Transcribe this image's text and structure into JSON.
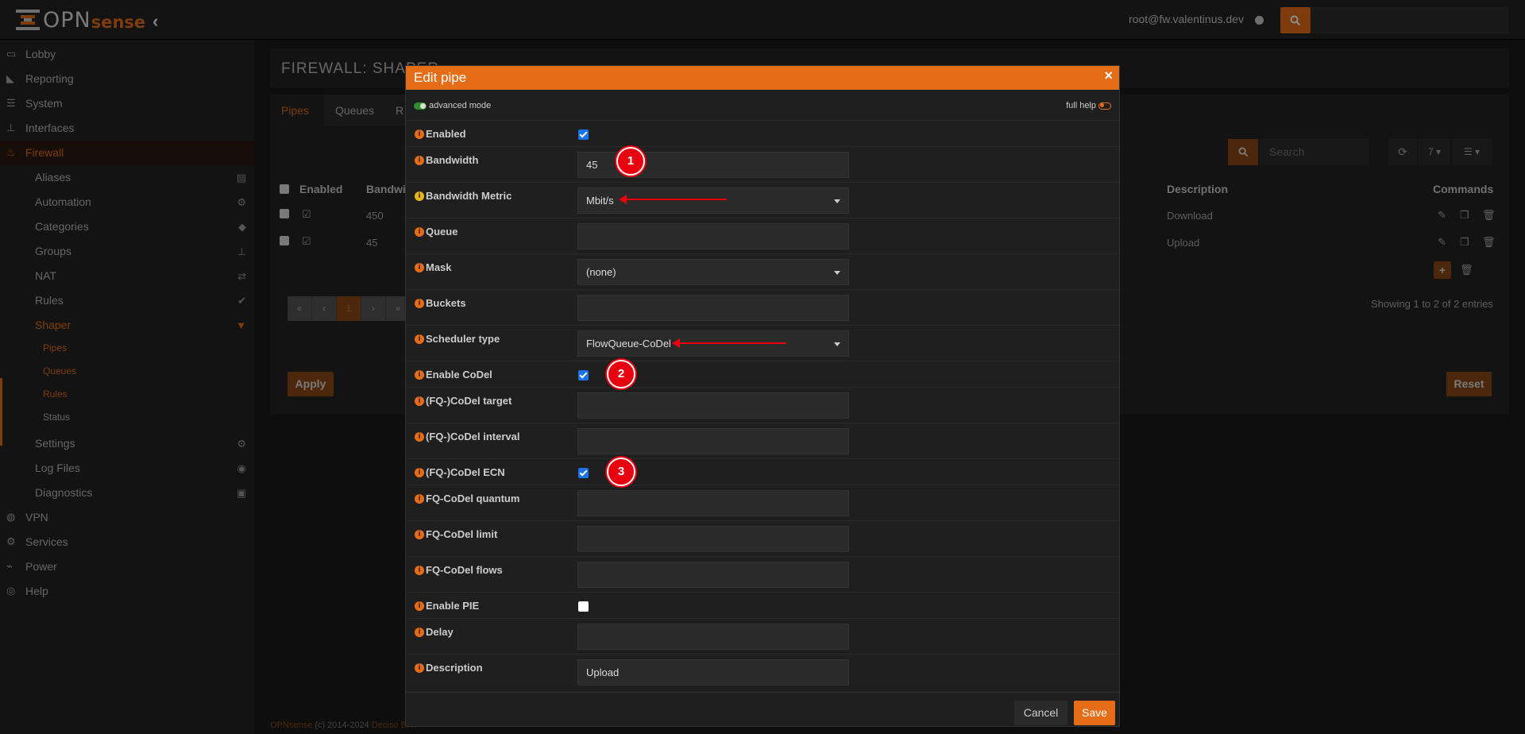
{
  "topbar": {
    "logo_main": "OPN",
    "logo_sub": "sense",
    "collapse_icon": "chevron-left-icon",
    "user": "root@fw.valentinus.dev",
    "search_placeholder": ""
  },
  "sidebar": {
    "items": [
      {
        "label": "Lobby",
        "icon": "laptop-icon"
      },
      {
        "label": "Reporting",
        "icon": "chart-area-icon"
      },
      {
        "label": "System",
        "icon": "server-icon"
      },
      {
        "label": "Interfaces",
        "icon": "sitemap-icon"
      },
      {
        "label": "Firewall",
        "icon": "fire-icon"
      }
    ],
    "firewall_sub": [
      {
        "label": "Aliases",
        "icon": "list-alt-icon"
      },
      {
        "label": "Automation",
        "icon": "cog-icon"
      },
      {
        "label": "Categories",
        "icon": "tags-icon"
      },
      {
        "label": "Groups",
        "icon": "sitemap-icon"
      },
      {
        "label": "NAT",
        "icon": "exchange-icon"
      },
      {
        "label": "Rules",
        "icon": "check-icon"
      },
      {
        "label": "Shaper",
        "icon": "filter-icon"
      }
    ],
    "shaper_sub": [
      {
        "label": "Pipes"
      },
      {
        "label": "Queues"
      },
      {
        "label": "Rules"
      },
      {
        "label": "Status"
      }
    ],
    "firewall_sub2": [
      {
        "label": "Settings",
        "icon": "cogs-icon"
      },
      {
        "label": "Log Files",
        "icon": "eye-icon"
      },
      {
        "label": "Diagnostics",
        "icon": "medkit-icon"
      }
    ],
    "items2": [
      {
        "label": "VPN",
        "icon": "globe-icon"
      },
      {
        "label": "Services",
        "icon": "cog-icon"
      },
      {
        "label": "Power",
        "icon": "plug-icon"
      },
      {
        "label": "Help",
        "icon": "life-ring-icon"
      }
    ]
  },
  "page": {
    "title": "FIREWALL: SHAPER",
    "tabs": [
      "Pipes",
      "Queues",
      "R"
    ],
    "search_placeholder": "Search",
    "page_size": "7",
    "columns": [
      "Enabled",
      "Bandwi",
      "Description",
      "Commands"
    ],
    "rows": [
      {
        "bandwidth": "450",
        "description": "Download"
      },
      {
        "bandwidth": "45",
        "description": "Upload"
      }
    ],
    "paging": [
      "«",
      "‹",
      "1",
      "›",
      "»"
    ],
    "showing": "Showing 1 to 2 of 2 entries",
    "apply": "Apply",
    "reset": "Reset",
    "footer_brand": "OPNsense",
    "footer_copy": " (c) 2014-2024 ",
    "footer_company": "Deciso B.V."
  },
  "modal": {
    "title": "Edit pipe",
    "close": "×",
    "advanced_mode": "advanced mode",
    "full_help": "full help",
    "fields": {
      "enabled": "Enabled",
      "bandwidth": "Bandwidth",
      "bandwidth_value": "45",
      "bandwidth_metric": "Bandwidth Metric",
      "bandwidth_metric_value": "Mbit/s",
      "queue": "Queue",
      "mask": "Mask",
      "mask_value": "(none)",
      "buckets": "Buckets",
      "scheduler_type": "Scheduler type",
      "scheduler_value": "FlowQueue-CoDel",
      "enable_codel": "Enable CoDel",
      "codel_target": "(FQ-)CoDel target",
      "codel_interval": "(FQ-)CoDel interval",
      "codel_ecn": "(FQ-)CoDel ECN",
      "fq_quantum": "FQ-CoDel quantum",
      "fq_limit": "FQ-CoDel limit",
      "fq_flows": "FQ-CoDel flows",
      "enable_pie": "Enable PIE",
      "delay": "Delay",
      "description": "Description",
      "description_value": "Upload"
    },
    "cancel": "Cancel",
    "save": "Save"
  },
  "annotations": [
    "1",
    "2",
    "3"
  ],
  "colors": {
    "accent": "#e66d17",
    "annotation": "#e8000f",
    "checkbox": "#1a73e8"
  }
}
